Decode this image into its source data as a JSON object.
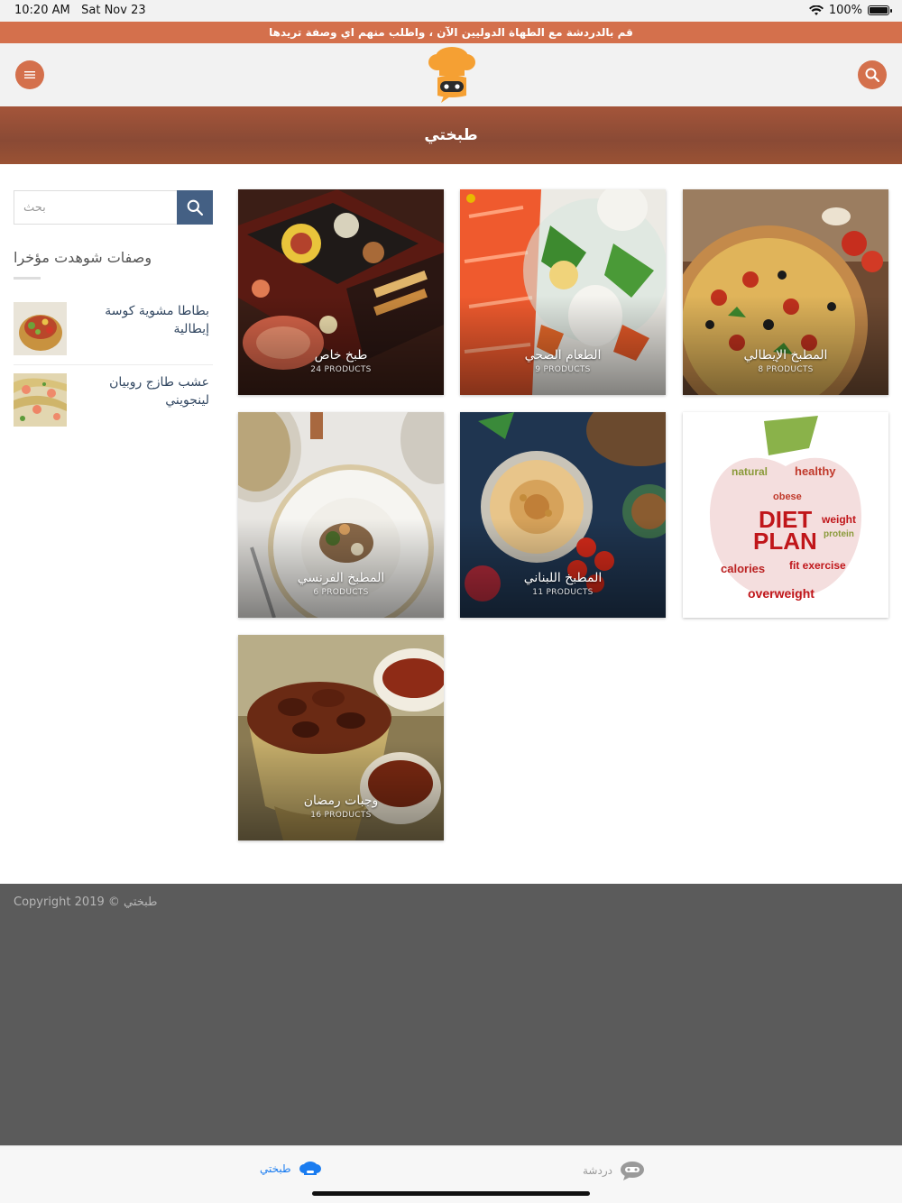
{
  "status": {
    "time": "10:20 AM",
    "date": "Sat Nov 23",
    "battery": "100%"
  },
  "promo_text": "قم بالدردشة مع الطهاة الدوليين الآن ، واطلب منهم اي وصفة تريدها",
  "page_title": "طبختي",
  "search": {
    "placeholder": "بحث"
  },
  "sidebar": {
    "widget_title": "وصفات شوهدت مؤخرا",
    "recent": [
      {
        "title": "بطاطا مشوية كوسة إيطالية"
      },
      {
        "title": "عشب طازج روبيان لينجويني"
      }
    ]
  },
  "categories": [
    {
      "title": "طبخ خاص",
      "count": "24 PRODUCTS",
      "theme": "osechi"
    },
    {
      "title": "الطعام الصحي",
      "count": "9 PRODUCTS",
      "theme": "salmon"
    },
    {
      "title": "المطبخ الإيطالي",
      "count": "8 PRODUCTS",
      "theme": "pizza"
    },
    {
      "title": "المطبخ الفرنسي",
      "count": "6 PRODUCTS",
      "theme": "plate"
    },
    {
      "title": "المطبخ اللبناني",
      "count": "11 PRODUCTS",
      "theme": "hummus"
    },
    {
      "title": "",
      "count": "",
      "theme": "diet",
      "art_text": [
        "natural",
        "healthy",
        "DIET",
        "PLAN",
        "calories",
        "fit exercise",
        "protein",
        "weight",
        "obese",
        "overweight"
      ]
    },
    {
      "title": "وجبات رمضان",
      "count": "16 PRODUCTS",
      "theme": "dates"
    }
  ],
  "footer": {
    "copyright": "Copyright 2019 © طبختي"
  },
  "tabs": [
    {
      "label": "طبختي",
      "icon": "chef-hat-icon",
      "active": true
    },
    {
      "label": "دردشة",
      "icon": "chat-bubble-icon",
      "active": false
    }
  ],
  "colors": {
    "accent": "#d4704c",
    "header_band": "#8a4a35",
    "search_button": "#446084",
    "footer": "#5b5b5b",
    "tab_active": "#1a7cf0"
  },
  "icons": {
    "menu": "menu-icon",
    "search": "search-icon",
    "wifi": "wifi-icon",
    "battery": "battery-icon",
    "logo": "chef-logo-icon"
  }
}
